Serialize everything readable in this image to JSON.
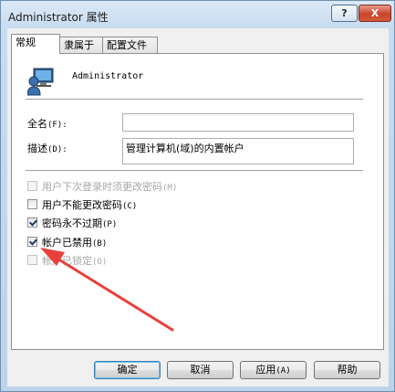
{
  "window": {
    "title": "Administrator 属性",
    "help_label": "?",
    "close_label": "X"
  },
  "tabs": [
    {
      "label": "常规"
    },
    {
      "label": "隶属于"
    },
    {
      "label": "配置文件"
    }
  ],
  "user": {
    "name": "Administrator"
  },
  "fields": {
    "fullname_label": "全名",
    "fullname_mn": "(F):",
    "fullname_value": "",
    "desc_label": "描述",
    "desc_mn": "(D):",
    "desc_value": "管理计算机(域)的内置帐户"
  },
  "checkboxes": [
    {
      "label": "用户下次登录时须更改密码",
      "mn": "(M)",
      "checked": false,
      "disabled": true
    },
    {
      "label": "用户不能更改密码",
      "mn": "(C)",
      "checked": false,
      "disabled": false
    },
    {
      "label": "密码永不过期",
      "mn": "(P)",
      "checked": true,
      "disabled": false
    },
    {
      "label": "帐户已禁用",
      "mn": "(B)",
      "checked": true,
      "disabled": false
    },
    {
      "label": "帐户已锁定",
      "mn": "(O)",
      "checked": false,
      "disabled": true
    }
  ],
  "buttons": {
    "ok": "确定",
    "cancel": "取消",
    "apply": "应用",
    "apply_mn": "(A)",
    "help": "帮助"
  },
  "colors": {
    "annotation_arrow": "#e8403c"
  }
}
